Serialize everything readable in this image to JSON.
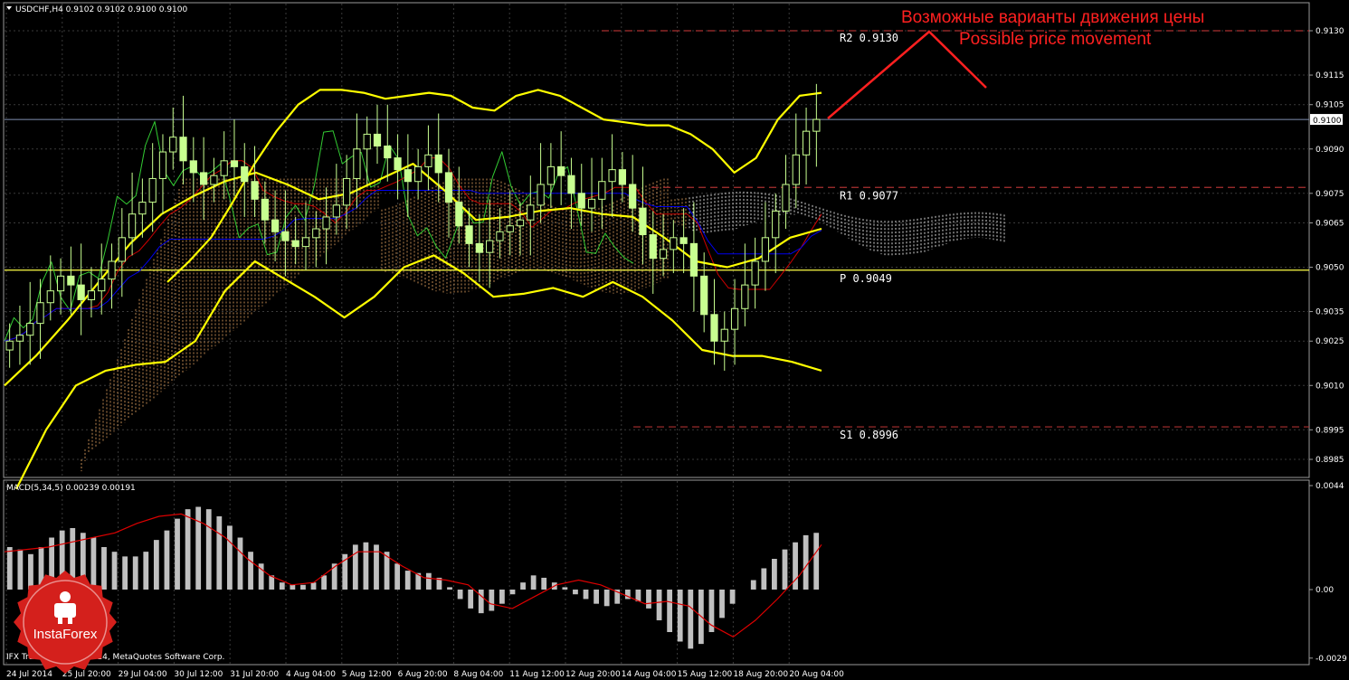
{
  "header": {
    "symbol_line": "USDCHF,H4  0.9102 0.9102 0.9100 0.9100",
    "macd_label": "MACD(5,34,5) 0.00239 0.00191"
  },
  "footer": {
    "copyright": "IFX Trader, © 2001-2014, MetaQuotes Software Corp."
  },
  "logo": {
    "text": "InstaForex",
    "color": "#d4201c"
  },
  "annotation": {
    "ru": "Возможные варианты движения цены",
    "en": "Possible price movement",
    "color": "#ff2020"
  },
  "colors": {
    "background": "#000000",
    "grid": "#3a3a3a",
    "candle": "#c8ff90",
    "bollinger": "#ffff00",
    "chikou": "#33cc33",
    "tenkan": "#cc0000",
    "kijun": "#0000ee",
    "cloud": "#e0a060",
    "cloud2": "#ffffff",
    "pivot": "#ffff44",
    "resistance": "#aa3030",
    "macd_hist": "#c0c0c0",
    "macd_signal": "#dd0000"
  },
  "chart_data": [
    {
      "type": "candlestick",
      "symbol": "USDCHF",
      "timeframe": "H4",
      "ylim": [
        0.898,
        0.9144
      ],
      "y_ticks": [
        "0.9130",
        "0.9115",
        "0.9105",
        "0.9090",
        "0.9075",
        "0.9065",
        "0.9050",
        "0.9035",
        "0.9025",
        "0.9010",
        "0.8995",
        "0.8985"
      ],
      "current_price": "0.9100",
      "x_ticks": [
        "24 Jul 2014",
        "25 Jul 20:00",
        "29 Jul 04:00",
        "30 Jul 12:00",
        "31 Jul 20:00",
        "4 Aug 04:00",
        "5 Aug 12:00",
        "6 Aug 20:00",
        "8 Aug 04:00",
        "11 Aug 12:00",
        "12 Aug 20:00",
        "14 Aug 04:00",
        "15 Aug 12:00",
        "18 Aug 20:00",
        "20 Aug 04:00"
      ],
      "levels": [
        {
          "name": "R2",
          "label": "R2 0.9130",
          "value": 0.913
        },
        {
          "name": "R1",
          "label": "R1 0.9077",
          "value": 0.9077
        },
        {
          "name": "P",
          "label": "P 0.9049",
          "value": 0.9049
        },
        {
          "name": "S1",
          "label": "S1 0.8996",
          "value": 0.8996
        }
      ],
      "close": [
        0.9025,
        0.9027,
        0.9031,
        0.9038,
        0.9042,
        0.9047,
        0.9044,
        0.9039,
        0.9042,
        0.9046,
        0.9052,
        0.906,
        0.9068,
        0.9072,
        0.908,
        0.9089,
        0.9094,
        0.9086,
        0.9082,
        0.9078,
        0.9081,
        0.9086,
        0.9084,
        0.9079,
        0.9073,
        0.9066,
        0.9062,
        0.9059,
        0.9057,
        0.906,
        0.9063,
        0.9067,
        0.9071,
        0.908,
        0.909,
        0.9095,
        0.9091,
        0.9087,
        0.9083,
        0.9079,
        0.9084,
        0.9088,
        0.9082,
        0.9072,
        0.9064,
        0.9058,
        0.9055,
        0.9059,
        0.9062,
        0.9064,
        0.9066,
        0.9071,
        0.9078,
        0.9084,
        0.9081,
        0.9075,
        0.907,
        0.9073,
        0.9079,
        0.9083,
        0.9078,
        0.907,
        0.9061,
        0.9053,
        0.9056,
        0.906,
        0.9058,
        0.9047,
        0.9034,
        0.9025,
        0.9029,
        0.9036,
        0.9044,
        0.9052,
        0.906,
        0.9069,
        0.9078,
        0.9088,
        0.9096,
        0.91
      ],
      "bollinger_upper": [
        0.9045,
        0.9052,
        0.906,
        0.9072,
        0.9085,
        0.9096,
        0.9105,
        0.911,
        0.911,
        0.9109,
        0.9107,
        0.9108,
        0.9109,
        0.9108,
        0.9104,
        0.9103,
        0.9108,
        0.911,
        0.9108,
        0.9104,
        0.91,
        0.9099,
        0.9098,
        0.9098,
        0.9095,
        0.909,
        0.9082,
        0.9087,
        0.91,
        0.9108,
        0.9109
      ],
      "bollinger_middle": [
        0.901,
        0.902,
        0.9032,
        0.9045,
        0.9058,
        0.9068,
        0.9074,
        0.9079,
        0.9082,
        0.9078,
        0.9073,
        0.9075,
        0.908,
        0.9085,
        0.9076,
        0.9066,
        0.9067,
        0.9069,
        0.907,
        0.9068,
        0.9067,
        0.906,
        0.9052,
        0.905,
        0.9053,
        0.906,
        0.9063
      ],
      "bollinger_lower": [
        0.8975,
        0.8995,
        0.901,
        0.9015,
        0.9017,
        0.9018,
        0.9025,
        0.9042,
        0.9052,
        0.9046,
        0.904,
        0.9033,
        0.904,
        0.905,
        0.9054,
        0.9048,
        0.904,
        0.9041,
        0.9043,
        0.904,
        0.9045,
        0.904,
        0.9032,
        0.9022,
        0.902,
        0.902,
        0.9018,
        0.9015
      ]
    },
    {
      "type": "bar",
      "name": "MACD(5,34,5)",
      "macd_value": "0.00239",
      "signal_value": "0.00191",
      "ylim": [
        -0.003,
        0.0045
      ],
      "y_ticks": [
        "0.0044",
        "0.00",
        "-0.0029"
      ],
      "values": [
        0.0018,
        0.0017,
        0.0015,
        0.0018,
        0.0022,
        0.0025,
        0.0026,
        0.0024,
        0.0022,
        0.0018,
        0.0016,
        0.0014,
        0.0014,
        0.0016,
        0.0021,
        0.0025,
        0.003,
        0.0034,
        0.0035,
        0.0034,
        0.0031,
        0.0027,
        0.0022,
        0.0016,
        0.0011,
        0.0006,
        0.0003,
        0.0002,
        0.0002,
        0.0003,
        0.0006,
        0.0011,
        0.0015,
        0.0019,
        0.002,
        0.0019,
        0.0016,
        0.0011,
        0.0008,
        0.0007,
        0.0007,
        0.0005,
        0.0001,
        -0.0004,
        -0.0008,
        -0.001,
        -0.0009,
        -0.0006,
        -0.0002,
        0.0003,
        0.0006,
        0.0005,
        0.0003,
        0.0001,
        -0.0002,
        -0.0004,
        -0.0006,
        -0.0007,
        -0.0006,
        -0.0004,
        -0.0005,
        -0.0008,
        -0.0013,
        -0.0018,
        -0.0022,
        -0.0025,
        -0.0023,
        -0.0018,
        -0.0012,
        -0.0006,
        0.0,
        0.0004,
        0.0009,
        0.0013,
        0.0017,
        0.002,
        0.0023,
        0.0024
      ],
      "signal": [
        0.0016,
        0.0017,
        0.0018,
        0.002,
        0.0022,
        0.0024,
        0.0028,
        0.0031,
        0.0032,
        0.0028,
        0.0022,
        0.0013,
        0.0006,
        0.0002,
        0.0003,
        0.001,
        0.0016,
        0.0016,
        0.001,
        0.0005,
        0.0004,
        0.0002,
        -0.0006,
        -0.0008,
        -0.0003,
        0.0002,
        0.0004,
        0.0002,
        -0.0002,
        -0.0006,
        -0.0005,
        -0.0007,
        -0.0015,
        -0.002,
        -0.0013,
        -0.0004,
        0.0006,
        0.0019
      ]
    }
  ]
}
